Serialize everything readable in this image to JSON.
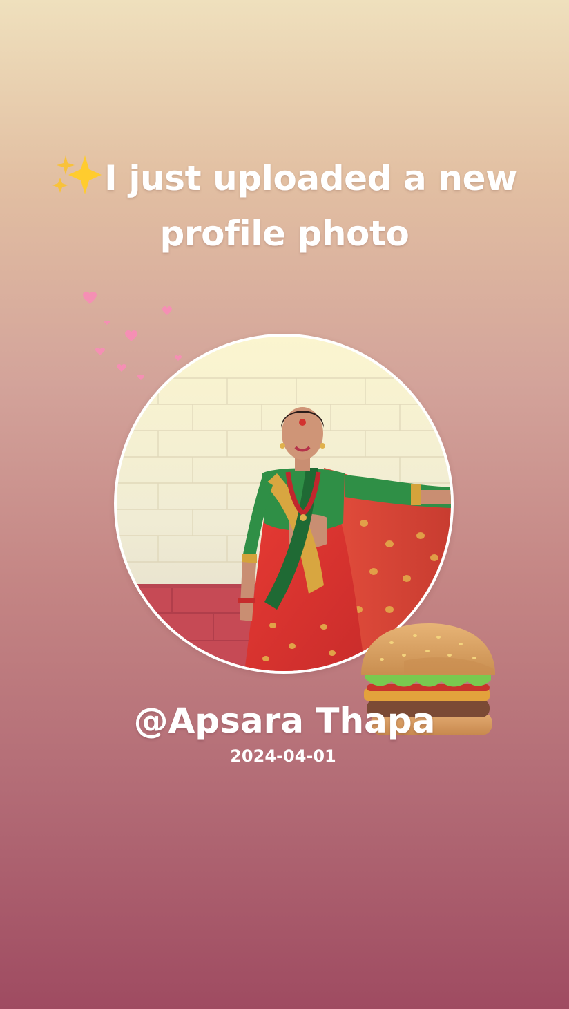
{
  "post": {
    "headline": "I just uploaded a new profile photo",
    "username": "@Apsara Thapa",
    "date": "2024-04-01"
  },
  "decorations": {
    "headline_icon": "sparkles-icon",
    "photo_icon": "profile-photo",
    "hearts_icon": "floating-hearts-icon",
    "sticker_icon": "hamburger-icon"
  },
  "colors": {
    "gradient_top": "#efe0bd",
    "gradient_bottom": "#9f4b61",
    "text": "#ffffff",
    "heart": "#f58fb4",
    "ring": "#ffffff"
  }
}
